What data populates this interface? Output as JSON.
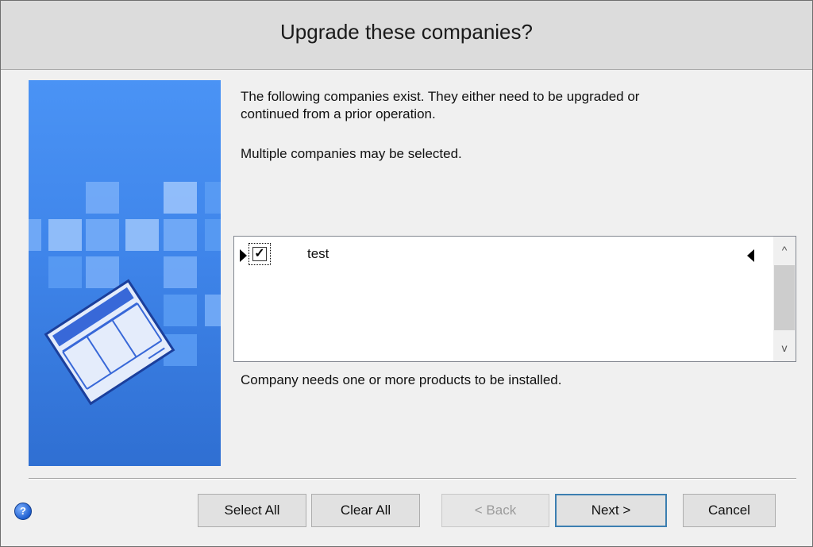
{
  "window": {
    "title": "Upgrade these companies?"
  },
  "info": {
    "line1": "The following companies exist. They either need to be upgraded or",
    "line2": "continued from a prior operation.",
    "line3": "Multiple companies may be selected."
  },
  "companies": [
    {
      "name": "test",
      "checked": true
    }
  ],
  "status": "Company needs one or more products to be installed.",
  "scrollbar": {
    "up": "^",
    "down": "v"
  },
  "buttons": {
    "select_all": "Select All",
    "clear_all": "Clear All",
    "back": "< Back",
    "next": "Next >",
    "cancel": "Cancel"
  },
  "help": {
    "glyph": "?"
  },
  "icons": [
    "help-icon",
    "check-icon",
    "arrow-left-icon",
    "arrow-right-icon",
    "scroll-up-icon",
    "scroll-down-icon"
  ],
  "colors": {
    "accent": "#3c7fb1",
    "art_panel": "#3f85ea"
  }
}
